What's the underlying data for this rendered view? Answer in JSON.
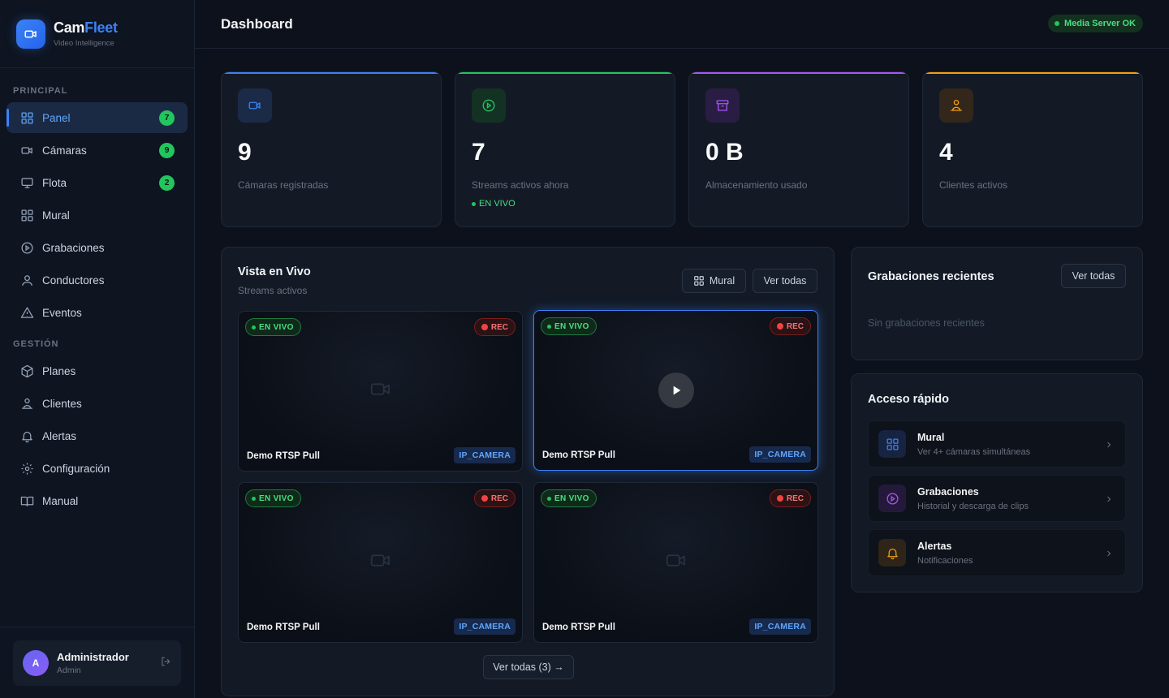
{
  "brand": {
    "name_part1": "Cam",
    "name_part2": "Fleet",
    "subtitle": "Video Intelligence"
  },
  "sidebar": {
    "section_principal": "PRINCIPAL",
    "section_gestion": "GESTIÓN",
    "principal_items": [
      {
        "label": "Panel",
        "icon": "grid-icon",
        "badge": "7",
        "active": true
      },
      {
        "label": "Cámaras",
        "icon": "video-camera-icon",
        "badge": "9"
      },
      {
        "label": "Flota",
        "icon": "monitor-icon",
        "badge": "2"
      },
      {
        "label": "Mural",
        "icon": "grid-icon"
      },
      {
        "label": "Grabaciones",
        "icon": "play-circle-icon"
      },
      {
        "label": "Conductores",
        "icon": "user-icon"
      },
      {
        "label": "Eventos",
        "icon": "warning-icon"
      }
    ],
    "gestion_items": [
      {
        "label": "Planes",
        "icon": "box-icon"
      },
      {
        "label": "Clientes",
        "icon": "network-icon"
      },
      {
        "label": "Alertas",
        "icon": "bell-icon"
      },
      {
        "label": "Configuración",
        "icon": "gear-icon"
      },
      {
        "label": "Manual",
        "icon": "book-icon"
      }
    ],
    "user": {
      "initial": "A",
      "name": "Administrador",
      "role": "Admin"
    }
  },
  "header": {
    "title": "Dashboard",
    "server_status": "Media Server OK"
  },
  "stats": [
    {
      "value": "9",
      "label": "Cámaras registradas",
      "color": "#3b82f6",
      "icon": "video-camera-icon"
    },
    {
      "value": "7",
      "label": "Streams activos ahora",
      "color": "#22c55e",
      "icon": "play-circle-icon",
      "live": "EN VIVO"
    },
    {
      "value": "0 B",
      "label": "Almacenamiento usado",
      "color": "#a855f7",
      "icon": "archive-icon"
    },
    {
      "value": "4",
      "label": "Clientes activos",
      "color": "#f59e0b",
      "icon": "network-icon"
    }
  ],
  "live_view": {
    "title": "Vista en Vivo",
    "subtitle": "Streams activos",
    "mural_button": "Mural",
    "see_all_button": "Ver todas",
    "footer_button": "Ver todas (3) →",
    "cameras": [
      {
        "live": "EN VIVO",
        "rec": "REC",
        "name": "Demo RTSP Pull",
        "type": "IP_CAMERA"
      },
      {
        "live": "EN VIVO",
        "rec": "REC",
        "name": "Demo RTSP Pull",
        "type": "IP_CAMERA",
        "selected": true
      },
      {
        "live": "EN VIVO",
        "rec": "REC",
        "name": "Demo RTSP Pull",
        "type": "IP_CAMERA"
      },
      {
        "live": "EN VIVO",
        "rec": "REC",
        "name": "Demo RTSP Pull",
        "type": "IP_CAMERA"
      }
    ]
  },
  "recent_recordings": {
    "title": "Grabaciones recientes",
    "see_all_button": "Ver todas",
    "empty": "Sin grabaciones recientes"
  },
  "quick_access": {
    "title": "Acceso rápido",
    "items": [
      {
        "title": "Mural",
        "desc": "Ver 4+ cámaras simultáneas",
        "icon": "grid-icon",
        "color": "#3b82f6"
      },
      {
        "title": "Grabaciones",
        "desc": "Historial y descarga de clips",
        "icon": "play-circle-icon",
        "color": "#a855f7"
      },
      {
        "title": "Alertas",
        "desc": "Notificaciones",
        "icon": "bell-icon",
        "color": "#f59e0b"
      }
    ]
  }
}
